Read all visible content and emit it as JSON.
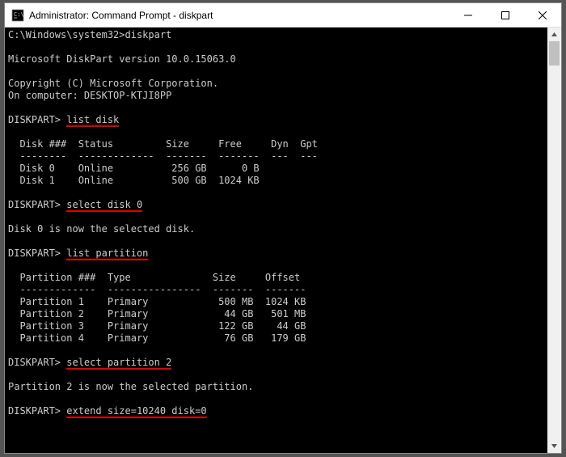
{
  "titlebar": {
    "title": "Administrator: Command Prompt - diskpart",
    "min_tooltip": "Minimize",
    "max_tooltip": "Maximize",
    "close_tooltip": "Close"
  },
  "terminal": {
    "initial_prompt": "C:\\Windows\\system32>",
    "initial_cmd": "diskpart",
    "blank": " ",
    "version_line": "Microsoft DiskPart version 10.0.15063.0",
    "copyright_line": "Copyright (C) Microsoft Corporation.",
    "computer_line": "On computer: DESKTOP-KTJI8PP",
    "prompt": "DISKPART> ",
    "cmd_list_disk": "list disk",
    "disk_header": "  Disk ###  Status         Size     Free     Dyn  Gpt",
    "disk_divider": "  --------  -------------  -------  -------  ---  ---",
    "disk_row_0": "  Disk 0    Online          256 GB      0 B",
    "disk_row_1": "  Disk 1    Online          500 GB  1024 KB",
    "cmd_select_disk": "select disk 0",
    "select_disk_result": "Disk 0 is now the selected disk.",
    "cmd_list_partition": "list partition",
    "part_header": "  Partition ###  Type              Size     Offset",
    "part_divider": "  -------------  ----------------  -------  -------",
    "part_row_1": "  Partition 1    Primary            500 MB  1024 KB",
    "part_row_2": "  Partition 2    Primary             44 GB   501 MB",
    "part_row_3": "  Partition 3    Primary            122 GB    44 GB",
    "part_row_4": "  Partition 4    Primary             76 GB   179 GB",
    "cmd_select_partition": "select partition 2",
    "select_partition_result": "Partition 2 is now the selected partition.",
    "cmd_extend": "extend size=10240 disk=0"
  }
}
